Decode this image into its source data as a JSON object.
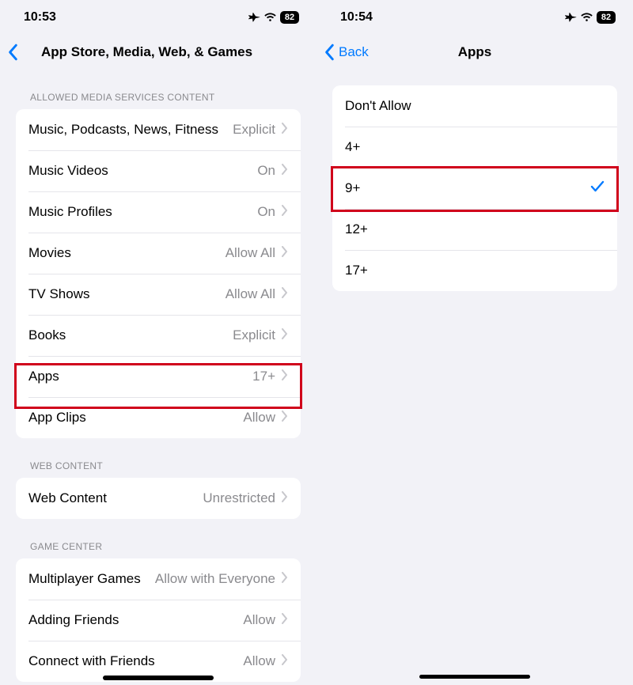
{
  "left": {
    "time": "10:53",
    "battery": "82",
    "title": "App Store, Media, Web, & Games",
    "section_media": "ALLOWED MEDIA SERVICES CONTENT",
    "rows_media": [
      {
        "label": "Music, Podcasts, News, Fitness",
        "value": "Explicit"
      },
      {
        "label": "Music Videos",
        "value": "On"
      },
      {
        "label": "Music Profiles",
        "value": "On"
      },
      {
        "label": "Movies",
        "value": "Allow All"
      },
      {
        "label": "TV Shows",
        "value": "Allow All"
      },
      {
        "label": "Books",
        "value": "Explicit"
      },
      {
        "label": "Apps",
        "value": "17+"
      },
      {
        "label": "App Clips",
        "value": "Allow"
      }
    ],
    "section_web": "WEB CONTENT",
    "rows_web": [
      {
        "label": "Web Content",
        "value": "Unrestricted"
      }
    ],
    "section_gc": "GAME CENTER",
    "rows_gc": [
      {
        "label": "Multiplayer Games",
        "value": "Allow with Everyone"
      },
      {
        "label": "Adding Friends",
        "value": "Allow"
      },
      {
        "label": "Connect with Friends",
        "value": "Allow"
      }
    ]
  },
  "right": {
    "time": "10:54",
    "battery": "82",
    "back_label": "Back",
    "title": "Apps",
    "rows": [
      {
        "label": "Don't Allow",
        "selected": false
      },
      {
        "label": "4+",
        "selected": false
      },
      {
        "label": "9+",
        "selected": true
      },
      {
        "label": "12+",
        "selected": false
      },
      {
        "label": "17+",
        "selected": false
      }
    ]
  }
}
